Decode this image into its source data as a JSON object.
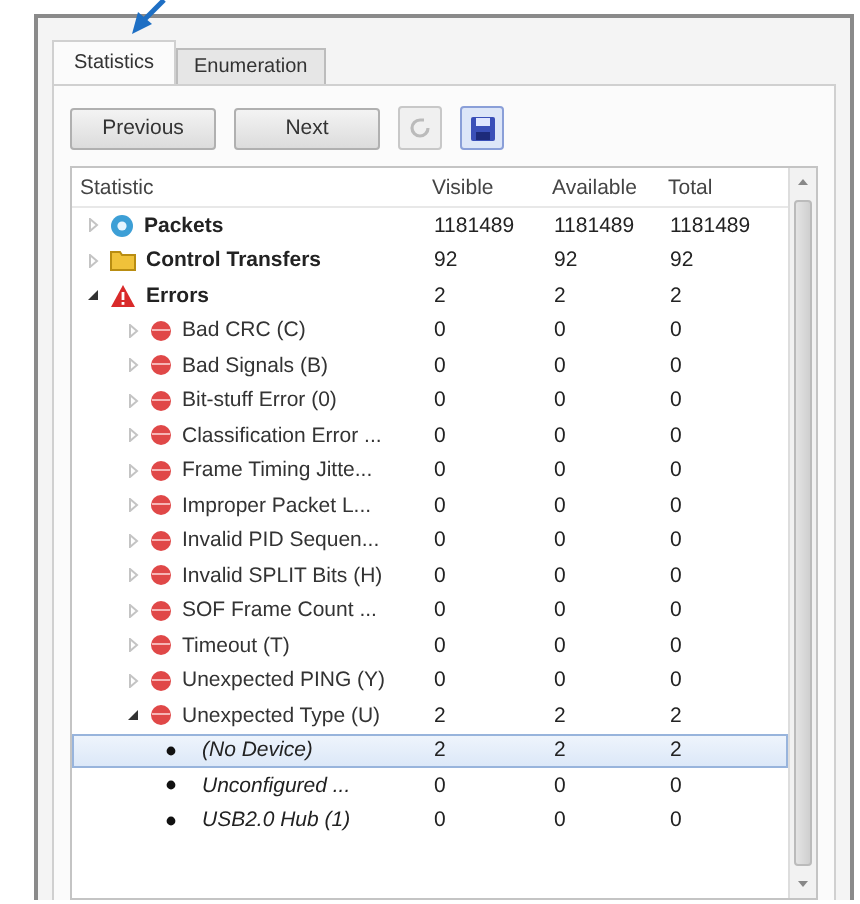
{
  "tabs": [
    {
      "label": "Statistics",
      "selected": true
    },
    {
      "label": "Enumeration",
      "selected": false
    }
  ],
  "toolbar": {
    "buttons": [
      "Previous",
      "Next"
    ]
  },
  "table": {
    "columns": [
      "Statistic",
      "Visible",
      "Available",
      "Total"
    ],
    "rows": [
      {
        "label": "Packets",
        "kind": "circle",
        "expanded": false,
        "visible": "1181489",
        "available": "1181489",
        "total": "1181489",
        "selected": false
      },
      {
        "label": "Control Transfers",
        "kind": "folder",
        "expanded": false,
        "visible": "92",
        "available": "92",
        "total": "92",
        "selected": false
      },
      {
        "label": "Errors",
        "kind": "warning",
        "expanded": true,
        "visible": "2",
        "available": "2",
        "total": "2",
        "selected": false,
        "children": [
          {
            "label": "Bad CRC (C)",
            "kind": "dot",
            "expanded": false,
            "visible": "0",
            "available": "0",
            "total": "0",
            "selected": false
          },
          {
            "label": "Bad Signals (B)",
            "kind": "dot",
            "expanded": false,
            "visible": "0",
            "available": "0",
            "total": "0",
            "selected": false
          },
          {
            "label": "Bit-stuff Error (0)",
            "kind": "dot",
            "expanded": false,
            "visible": "0",
            "available": "0",
            "total": "0",
            "selected": false
          },
          {
            "label": "Classification Error ...",
            "kind": "dot",
            "expanded": false,
            "visible": "0",
            "available": "0",
            "total": "0",
            "selected": false
          },
          {
            "label": "Frame Timing Jitte...",
            "kind": "dot",
            "expanded": false,
            "visible": "0",
            "available": "0",
            "total": "0",
            "selected": false
          },
          {
            "label": "Improper Packet L...",
            "kind": "dot",
            "expanded": false,
            "visible": "0",
            "available": "0",
            "total": "0",
            "selected": false
          },
          {
            "label": "Invalid PID Sequen...",
            "kind": "dot",
            "expanded": false,
            "visible": "0",
            "available": "0",
            "total": "0",
            "selected": false
          },
          {
            "label": "Invalid SPLIT Bits (H)",
            "kind": "dot",
            "expanded": false,
            "visible": "0",
            "available": "0",
            "total": "0",
            "selected": false
          },
          {
            "label": "SOF Frame Count ...",
            "kind": "dot",
            "expanded": false,
            "visible": "0",
            "available": "0",
            "total": "0",
            "selected": false
          },
          {
            "label": "Timeout (T)",
            "kind": "dot",
            "expanded": false,
            "visible": "0",
            "available": "0",
            "total": "0",
            "selected": false
          },
          {
            "label": "Unexpected PING (Y)",
            "kind": "dot",
            "expanded": false,
            "visible": "0",
            "available": "0",
            "total": "0",
            "selected": false
          },
          {
            "label": "Unexpected Type (U)",
            "kind": "dot",
            "expanded": true,
            "visible": "2",
            "available": "2",
            "total": "2",
            "selected": false,
            "children": [
              {
                "label": "(No Device)",
                "kind": "bullet",
                "visible": "2",
                "available": "2",
                "total": "2",
                "selected": true
              },
              {
                "label": "Unconfigured ...",
                "kind": "bullet",
                "visible": "0",
                "available": "0",
                "total": "0",
                "selected": false
              },
              {
                "label": "USB2.0 Hub (1)",
                "kind": "bullet",
                "visible": "0",
                "available": "0",
                "total": "0",
                "selected": false
              }
            ]
          }
        ]
      }
    ]
  }
}
